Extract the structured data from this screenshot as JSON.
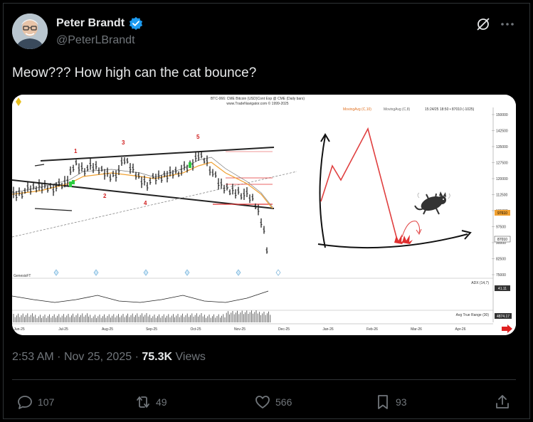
{
  "author": {
    "display_name": "Peter Brandt",
    "handle": "@PeterLBrandt",
    "verified": true
  },
  "tweet": {
    "text": "Meow??? How high can the cat bounce?"
  },
  "meta": {
    "time": "2:53 AM",
    "separator": "·",
    "date": "Nov 25, 2025",
    "views_count": "75.3K",
    "views_label": "Views"
  },
  "actions": {
    "replies": "107",
    "reposts": "49",
    "likes": "566",
    "bookmarks": "93"
  },
  "chart": {
    "header_line1": "BTC-066: CME Bitcoin (USD)Cont Exp @ CME (Daily bars)",
    "header_line2": "www.TradeNavigator.com © 1999-2025",
    "legend_ma1": "MovingAvg (C,10)",
    "legend_ma2": "MovingAvg (C,8)",
    "legend_stats": "15:24/25 18:50 • 87010 (-1025)",
    "price_labels": [
      "150000",
      "142500",
      "135000",
      "127500",
      "120000",
      "112500",
      "105000",
      "97500",
      "90000",
      "82500",
      "75000"
    ],
    "current_price_tag": "87010",
    "orange_price_tag": "97610",
    "wave_labels": [
      "1",
      "2",
      "3",
      "4",
      "5"
    ],
    "genesis_label": "GenesisFT",
    "adx_label": "ADX (14,7)",
    "adx_value": "41.11",
    "atr_label": "Avg True Range (30)",
    "atr_value": "4874.17",
    "x_labels": [
      "Jun-25",
      "Jul-25",
      "Aug-25",
      "Sep-25",
      "Oct-25",
      "Nov-25",
      "Dec-25",
      "Jan-26",
      "Feb-26",
      "Mar-26",
      "Apr-26"
    ],
    "colors": {
      "up_bar": "#2ecc40",
      "ma_orange": "#f0a030",
      "resistance_red": "#e03030",
      "annotation_red": "#e04040",
      "wave_red": "#d02020"
    }
  }
}
